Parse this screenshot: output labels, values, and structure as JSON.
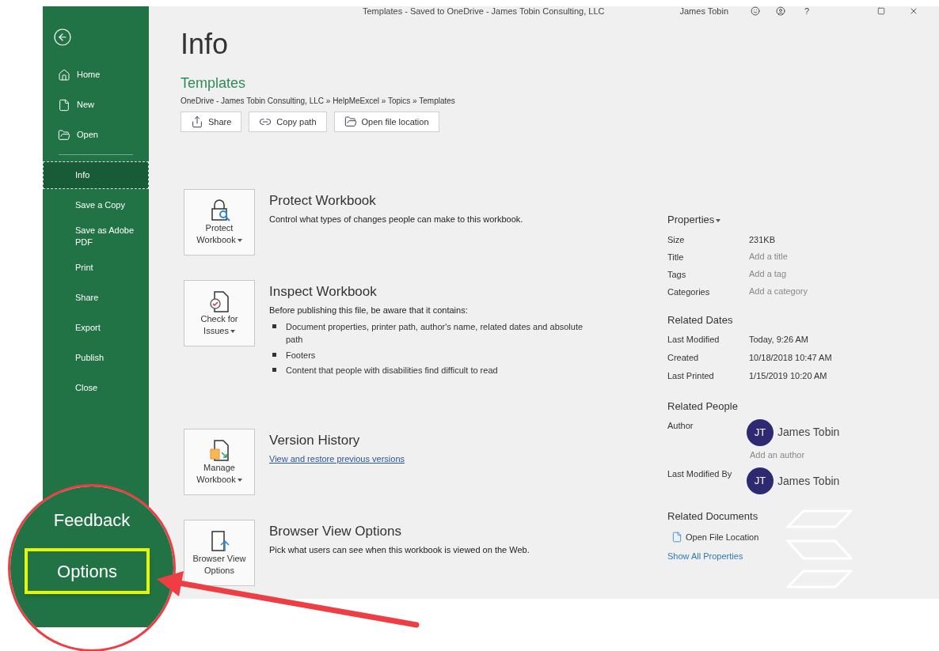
{
  "title_bar": {
    "title": "Templates - Saved to OneDrive - James Tobin Consulting, LLC",
    "user": "James Tobin",
    "help": "?"
  },
  "sidebar": {
    "items": [
      {
        "label": "Home",
        "kind": "home",
        "selected": false
      },
      {
        "label": "New",
        "kind": "new",
        "selected": false
      },
      {
        "label": "Open",
        "kind": "open",
        "selected": false
      },
      {
        "label": "Info",
        "kind": "text",
        "selected": true
      },
      {
        "label": "Save a Copy",
        "kind": "text",
        "selected": false
      },
      {
        "label": "Save as Adobe PDF",
        "kind": "text",
        "selected": false
      },
      {
        "label": "Print",
        "kind": "text",
        "selected": false
      },
      {
        "label": "Share",
        "kind": "text",
        "selected": false
      },
      {
        "label": "Export",
        "kind": "text",
        "selected": false
      },
      {
        "label": "Publish",
        "kind": "text",
        "selected": false
      },
      {
        "label": "Close",
        "kind": "text",
        "selected": false
      }
    ]
  },
  "callout": {
    "items": [
      {
        "label": "Feedback",
        "highlighted": false
      },
      {
        "label": "Options",
        "highlighted": true
      }
    ]
  },
  "main": {
    "heading": "Info",
    "file_name": "Templates",
    "path": "OneDrive - James Tobin Consulting, LLC » HelpMeExcel » Topics » Templates",
    "actions": [
      {
        "label": "Share",
        "kind": "share"
      },
      {
        "label": "Copy path",
        "kind": "link"
      },
      {
        "label": "Open file location",
        "kind": "folder"
      }
    ],
    "sections": [
      {
        "kind": "protect",
        "button": "Protect Workbook",
        "dropdown": true,
        "title": "Protect Workbook",
        "description": "Control what types of changes people can make to this workbook."
      },
      {
        "kind": "inspect",
        "button": "Check for Issues",
        "dropdown": true,
        "title": "Inspect Workbook",
        "description": "Before publishing this file, be aware that it contains:",
        "bullets": [
          "Document properties, printer path, author's name, related dates and absolute path",
          "Footers",
          "Content that people with disabilities find difficult to read"
        ]
      },
      {
        "kind": "manage",
        "button": "Manage Workbook",
        "dropdown": true,
        "title": "Version History",
        "link": "View and restore previous versions"
      },
      {
        "kind": "browser",
        "button": "Browser View Options",
        "dropdown": false,
        "title": "Browser View Options",
        "description": "Pick what users can see when this workbook is viewed on the Web."
      }
    ]
  },
  "properties": {
    "heading": "Properties",
    "rows": [
      {
        "label": "Size",
        "value": "231KB"
      },
      {
        "label": "Title",
        "placeholder": "Add a title"
      },
      {
        "label": "Tags",
        "placeholder": "Add a tag"
      },
      {
        "label": "Categories",
        "placeholder": "Add a category"
      }
    ],
    "dates_heading": "Related Dates",
    "dates": [
      {
        "label": "Last Modified",
        "value": "Today, 9:26 AM"
      },
      {
        "label": "Created",
        "value": "10/18/2018 10:47 AM"
      },
      {
        "label": "Last Printed",
        "value": "1/15/2019 10:20 AM"
      }
    ],
    "people_heading": "Related People",
    "people": [
      {
        "role": "Author",
        "initials": "JT",
        "name": "James Tobin",
        "add": "Add an author"
      },
      {
        "role": "Last Modified By",
        "initials": "JT",
        "name": "James Tobin"
      }
    ],
    "documents_heading": "Related Documents",
    "open_location": "Open File Location",
    "show_all": "Show All Properties"
  }
}
